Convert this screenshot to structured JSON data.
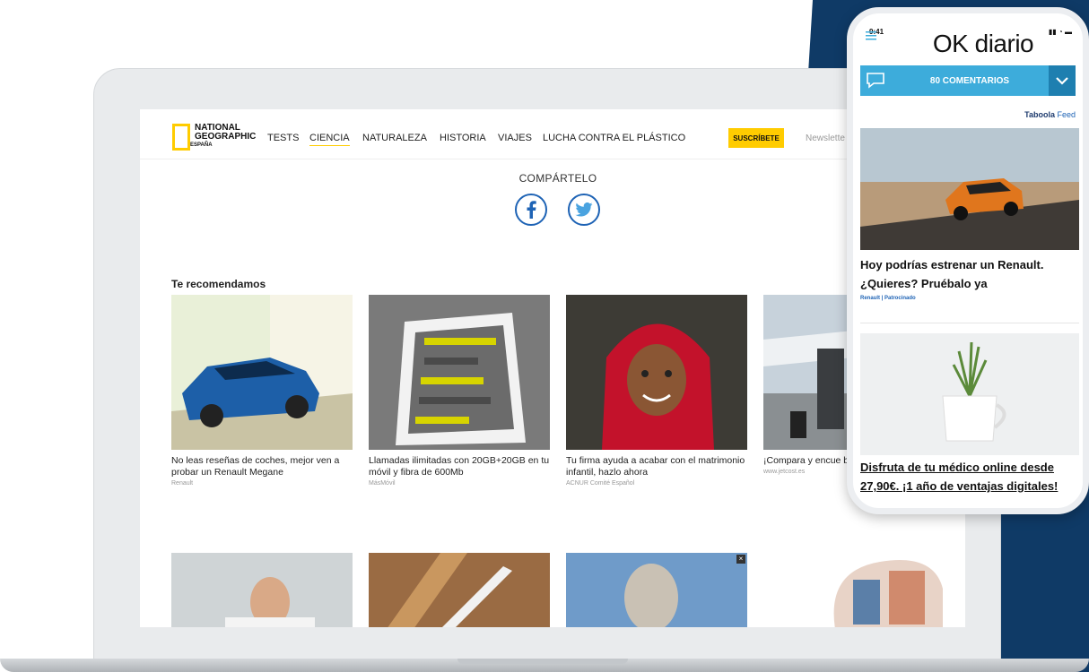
{
  "brand": {
    "logo_line1": "NATIONAL",
    "logo_line2": "GEOGRAPHIC",
    "logo_line3": "ESPAÑA"
  },
  "nav": {
    "items": [
      "TESTS",
      "CIENCIA",
      "NATURALEZA",
      "HISTORIA",
      "VIAJES",
      "LUCHA CONTRA EL PLÁSTICO"
    ],
    "active": "CIENCIA",
    "subscribe_label": "SUSCRÍBETE",
    "newsletter_label": "Newslette"
  },
  "share": {
    "label": "COMPÁRTELO",
    "icons": [
      "facebook-icon",
      "twitter-icon"
    ]
  },
  "recommend": {
    "title": "Te recomendamos",
    "cards": [
      {
        "title": "No leas reseñas de coches, mejor ven a probar un Renault Megane",
        "source": "Renault"
      },
      {
        "title": "Llamadas ilimitadas con 20GB+20GB en tu móvil y fibra de 600Mb",
        "source": "MásMóvil"
      },
      {
        "title": "Tu firma ayuda a acabar con el matrimonio infantil, hazlo ahora",
        "source": "ACNUR Comité Español"
      },
      {
        "title": "¡Compara y encue baratos! Vuelos a pa",
        "source": "www.jetcost.es"
      }
    ]
  },
  "phone": {
    "time": "9:41",
    "logo": "OK diario",
    "comments_label": "80 COMENTARIOS",
    "feed_brand": "Taboola",
    "feed_label": "Feed",
    "article1_title": "Hoy podrías estrenar un Renault. ¿Quieres? Pruébalo ya",
    "article1_source": "Renault | Patrocinado",
    "article2_title": "Disfruta de tu médico online desde 27,90€. ¡1 año de ventajas digitales!"
  },
  "colors": {
    "navy": "#0f3a66",
    "accent_yellow": "#ffcc00",
    "comments_blue": "#3dacdb",
    "link_blue": "#1e63b5"
  }
}
